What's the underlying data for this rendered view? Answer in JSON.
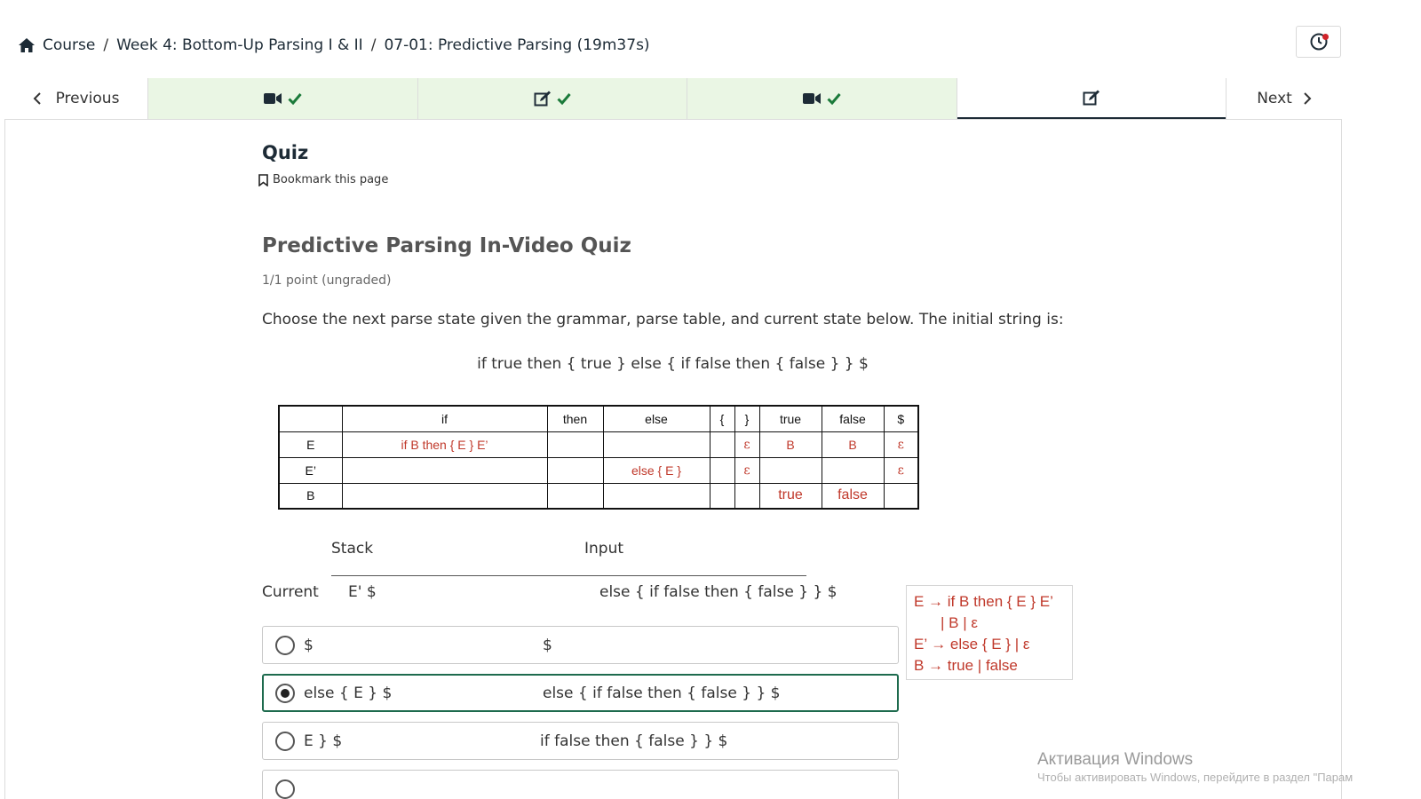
{
  "breadcrumb": {
    "course": "Course",
    "week": "Week 4: Bottom-Up Parsing I & II",
    "lesson": "07-01: Predictive Parsing (19m37s)"
  },
  "seqnav": {
    "previous": "Previous",
    "next": "Next",
    "tabs": [
      {
        "icon": "video-icon",
        "completed": true
      },
      {
        "icon": "edit-icon",
        "completed": true
      },
      {
        "icon": "video-icon",
        "completed": true
      },
      {
        "icon": "edit-icon",
        "completed": false,
        "active": true
      }
    ],
    "completed_bg": "#eaf6e4"
  },
  "unit": {
    "title": "Quiz",
    "bookmark": "Bookmark this page"
  },
  "problem": {
    "title": "Predictive Parsing In-Video Quiz",
    "points": "1/1 point (ungraded)",
    "prompt": "Choose the next parse state given the grammar, parse table, and current state below. The initial string is:",
    "initial_string": "if true then { true } else { if false then { false } } $"
  },
  "parse_table": {
    "headers": [
      "",
      "if",
      "then",
      "else",
      "{",
      "}",
      "true",
      "false",
      "$"
    ],
    "rows": [
      [
        "E",
        "if B then { E } E’",
        "",
        "",
        "",
        "ε",
        "B",
        "B",
        "ε"
      ],
      [
        "E’",
        "",
        "",
        "else { E }",
        "",
        "ε",
        "",
        "",
        "ε"
      ],
      [
        "B",
        "",
        "",
        "",
        "",
        "",
        "true",
        "false",
        ""
      ]
    ]
  },
  "state": {
    "stack_header": "Stack",
    "input_header": "Input",
    "current_label": "Current",
    "current_stack": "E' $",
    "current_input": "else { if false then { false } } $"
  },
  "grammar": {
    "line1": "E → if B then { E } E’",
    "line2": "| B | ε",
    "line3": "E’ → else { E } | ε",
    "line4": "B → true | false"
  },
  "options": [
    {
      "stack": "$",
      "input": "$",
      "selected": false
    },
    {
      "stack": "else { E } $",
      "input": "else { if false then { false } } $",
      "selected": true
    },
    {
      "stack": "E } $",
      "input": "if false then { false } } $",
      "selected": false
    }
  ],
  "watermark": {
    "title": "Активация Windows",
    "subtitle": "Чтобы активировать Windows, перейдите в раздел \"Парам"
  },
  "colors": {
    "accent": "#1e6b4e",
    "table_red": "#c0392b",
    "check_green": "#1b7a3a"
  }
}
